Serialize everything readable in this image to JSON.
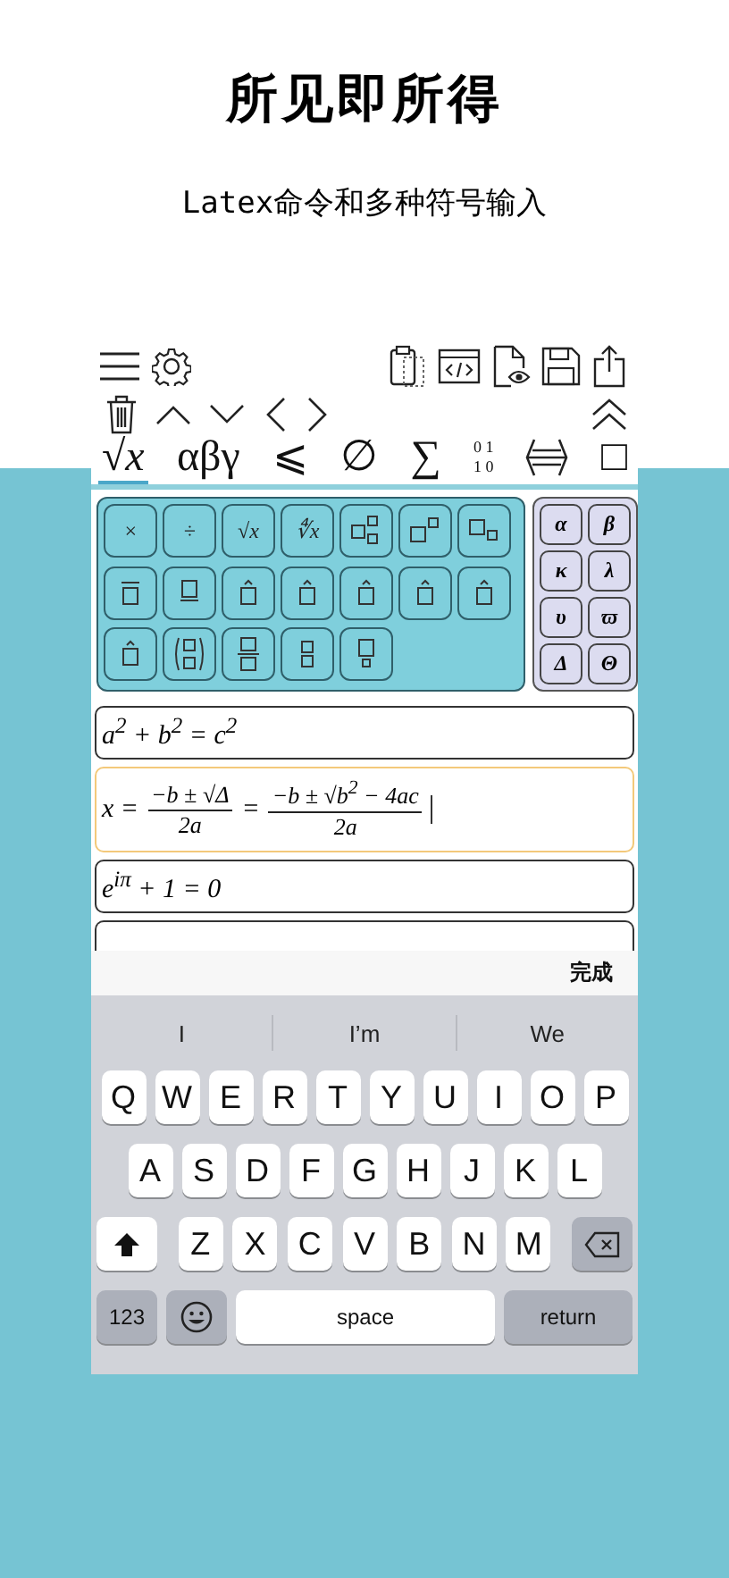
{
  "headline": "所见即所得",
  "subheadline": "Latex命令和多种符号输入",
  "tabs": [
    {
      "kind": "text",
      "label": "√x",
      "selected": true
    },
    {
      "kind": "text",
      "label": "αβγ",
      "selected": false
    },
    {
      "kind": "text",
      "label": "⩽",
      "selected": false
    },
    {
      "kind": "text",
      "label": "∅",
      "selected": false
    },
    {
      "kind": "text",
      "label": "∑",
      "selected": false
    },
    {
      "kind": "matrix",
      "rows": [
        "0 1",
        "1 0"
      ],
      "selected": false
    },
    {
      "kind": "icon",
      "selected": false
    },
    {
      "kind": "text",
      "label": "□",
      "selected": false
    }
  ],
  "palette": [
    {
      "kind": "text",
      "label": "×"
    },
    {
      "kind": "text",
      "label": "÷"
    },
    {
      "kind": "text",
      "label": "√x"
    },
    {
      "kind": "text",
      "label": "∜x"
    },
    {
      "kind": "supsub"
    },
    {
      "kind": "sup"
    },
    {
      "kind": "sub"
    },
    {
      "kind": "overbar"
    },
    {
      "kind": "underbar"
    },
    {
      "kind": "accent"
    },
    {
      "kind": "accent"
    },
    {
      "kind": "accent"
    },
    {
      "kind": "accent"
    },
    {
      "kind": "accent"
    },
    {
      "kind": "accent"
    },
    {
      "kind": "binom"
    },
    {
      "kind": "frac"
    },
    {
      "kind": "stack"
    },
    {
      "kind": "overset"
    }
  ],
  "greek": [
    "α",
    "β",
    "κ",
    "λ",
    "υ",
    "ϖ",
    "Δ",
    "Θ"
  ],
  "equations": [
    {
      "kind": "inline",
      "text": "a$^{2}$ + b$^{2}$ = c$^{2}$",
      "selected": false
    },
    {
      "kind": "parts",
      "selected": true,
      "parts": [
        {
          "kind": "text",
          "text": "x ="
        },
        {
          "kind": "frac",
          "num": "−b ± √Δ",
          "den": "2a"
        },
        {
          "kind": "text",
          "text": "="
        },
        {
          "kind": "frac",
          "num": "−b ± √b$^{2}$ − 4ac",
          "den": "2a"
        }
      ]
    },
    {
      "kind": "inline",
      "text": "e$^{iπ}$ + 1 = 0",
      "selected": false
    },
    {
      "kind": "cut",
      "selected": false
    }
  ],
  "accessory": {
    "done": "完成"
  },
  "suggestions": [
    "I",
    "I’m",
    "We"
  ],
  "keyboard": [
    [
      {
        "kind": "letter",
        "label": "Q"
      },
      {
        "kind": "letter",
        "label": "W"
      },
      {
        "kind": "letter",
        "label": "E"
      },
      {
        "kind": "letter",
        "label": "R"
      },
      {
        "kind": "letter",
        "label": "T"
      },
      {
        "kind": "letter",
        "label": "Y"
      },
      {
        "kind": "letter",
        "label": "U"
      },
      {
        "kind": "letter",
        "label": "I"
      },
      {
        "kind": "letter",
        "label": "O"
      },
      {
        "kind": "letter",
        "label": "P"
      }
    ],
    [
      {
        "kind": "letter",
        "label": "A"
      },
      {
        "kind": "letter",
        "label": "S"
      },
      {
        "kind": "letter",
        "label": "D"
      },
      {
        "kind": "letter",
        "label": "F"
      },
      {
        "kind": "letter",
        "label": "G"
      },
      {
        "kind": "letter",
        "label": "H"
      },
      {
        "kind": "letter",
        "label": "J"
      },
      {
        "kind": "letter",
        "label": "K"
      },
      {
        "kind": "letter",
        "label": "L"
      }
    ],
    [
      {
        "kind": "shift"
      },
      {
        "kind": "letter",
        "label": "Z"
      },
      {
        "kind": "letter",
        "label": "X"
      },
      {
        "kind": "letter",
        "label": "C"
      },
      {
        "kind": "letter",
        "label": "V"
      },
      {
        "kind": "letter",
        "label": "B"
      },
      {
        "kind": "letter",
        "label": "N"
      },
      {
        "kind": "letter",
        "label": "M"
      },
      {
        "kind": "delete"
      }
    ],
    [
      {
        "kind": "mode",
        "label": "123"
      },
      {
        "kind": "emoji"
      },
      {
        "kind": "space",
        "label": "space"
      },
      {
        "kind": "return",
        "label": "return"
      }
    ]
  ]
}
